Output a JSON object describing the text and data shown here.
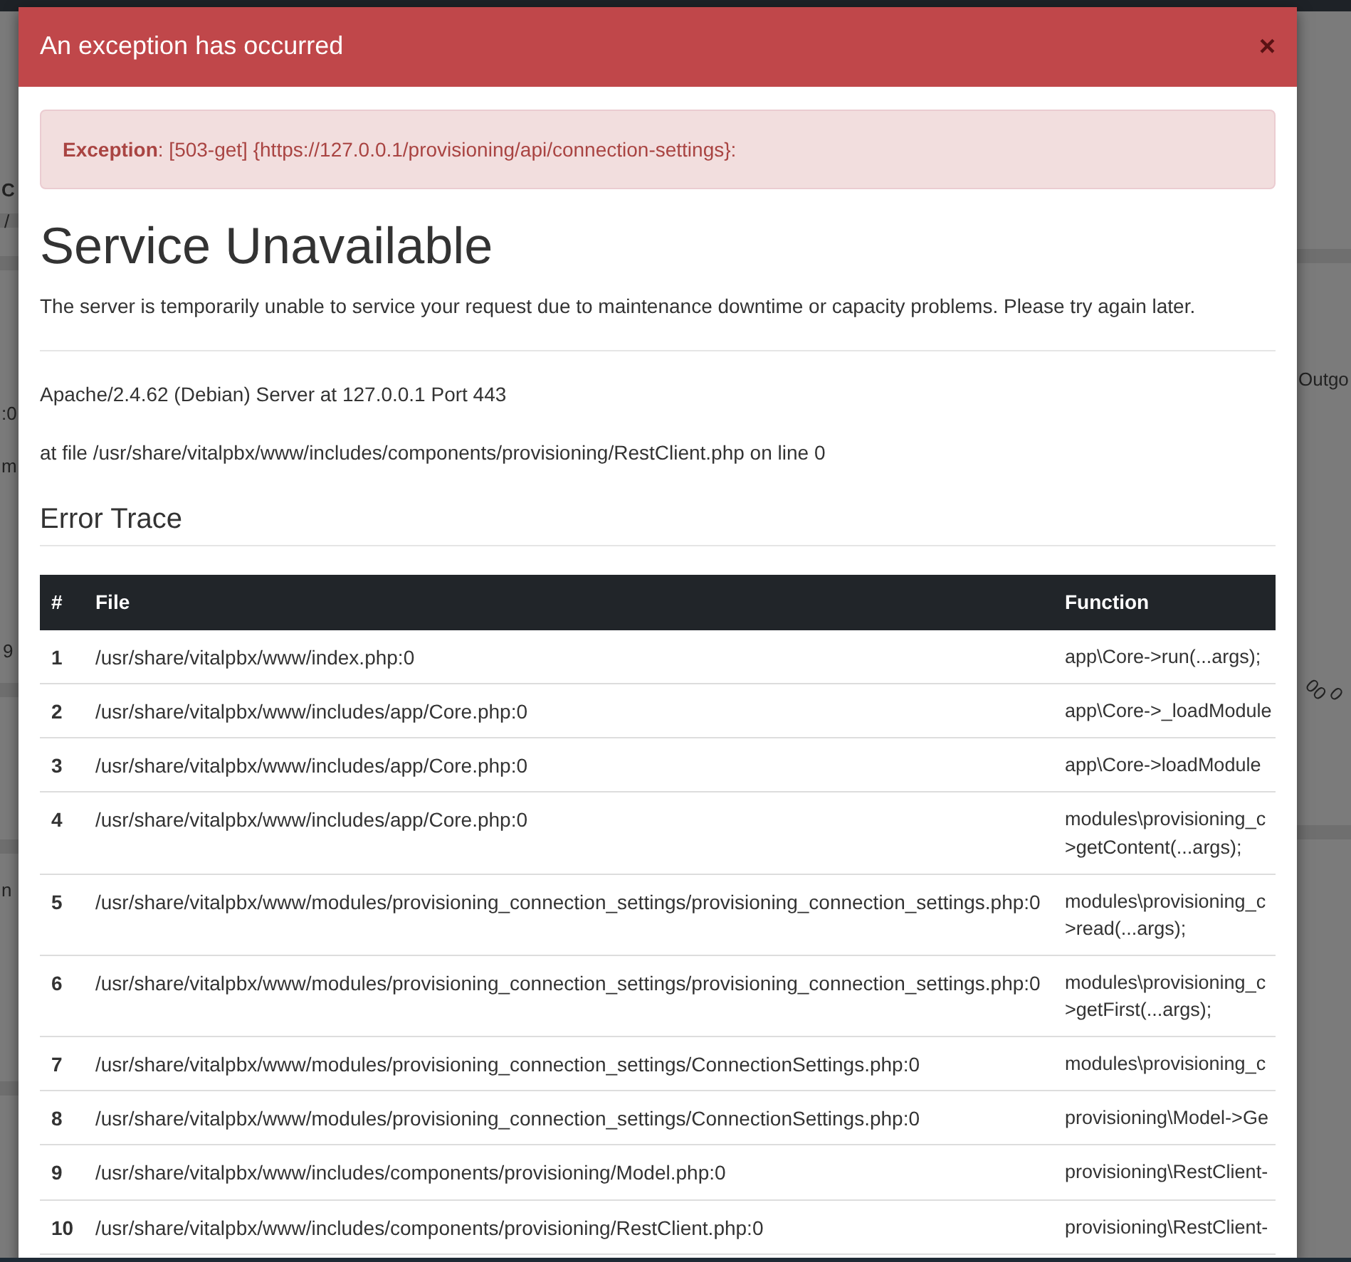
{
  "background": {
    "fragments": [
      "C",
      "/",
      ":0",
      "m",
      "9",
      "n",
      "Outgo",
      "00",
      "0"
    ]
  },
  "modal": {
    "title": "An exception has occurred",
    "close": "×",
    "alert": {
      "label": "Exception",
      "message": ": [503-get] {https://127.0.0.1/provisioning/api/connection-settings}:"
    },
    "heading": "Service Unavailable",
    "description": "The server is temporarily unable to service your request due to maintenance downtime or capacity problems. Please try again later.",
    "server_line": "Apache/2.4.62 (Debian) Server at 127.0.0.1 Port 443",
    "file_line": "at file /usr/share/vitalpbx/www/includes/components/provisioning/RestClient.php on line 0",
    "trace_title": "Error Trace",
    "table": {
      "columns": [
        "#",
        "File",
        "Function"
      ],
      "rows": [
        {
          "num": "1",
          "file": "/usr/share/vitalpbx/www/index.php:0",
          "function": [
            "app\\Core->run(...args);"
          ]
        },
        {
          "num": "2",
          "file": "/usr/share/vitalpbx/www/includes/app/Core.php:0",
          "function": [
            "app\\Core->_loadModule"
          ]
        },
        {
          "num": "3",
          "file": "/usr/share/vitalpbx/www/includes/app/Core.php:0",
          "function": [
            "app\\Core->loadModule"
          ]
        },
        {
          "num": "4",
          "file": "/usr/share/vitalpbx/www/includes/app/Core.php:0",
          "function": [
            "modules\\provisioning_c",
            ">getContent(...args);"
          ]
        },
        {
          "num": "5",
          "file": "/usr/share/vitalpbx/www/modules/provisioning_connection_settings/provisioning_connection_settings.php:0",
          "function": [
            "modules\\provisioning_c",
            ">read(...args);"
          ]
        },
        {
          "num": "6",
          "file": "/usr/share/vitalpbx/www/modules/provisioning_connection_settings/provisioning_connection_settings.php:0",
          "function": [
            "modules\\provisioning_c",
            ">getFirst(...args);"
          ]
        },
        {
          "num": "7",
          "file": "/usr/share/vitalpbx/www/modules/provisioning_connection_settings/ConnectionSettings.php:0",
          "function": [
            "modules\\provisioning_c"
          ]
        },
        {
          "num": "8",
          "file": "/usr/share/vitalpbx/www/modules/provisioning_connection_settings/ConnectionSettings.php:0",
          "function": [
            "provisioning\\Model->Ge"
          ]
        },
        {
          "num": "9",
          "file": "/usr/share/vitalpbx/www/includes/components/provisioning/Model.php:0",
          "function": [
            "provisioning\\RestClient-"
          ]
        },
        {
          "num": "10",
          "file": "/usr/share/vitalpbx/www/includes/components/provisioning/RestClient.php:0",
          "function": [
            "provisioning\\RestClient-"
          ]
        }
      ]
    }
  }
}
